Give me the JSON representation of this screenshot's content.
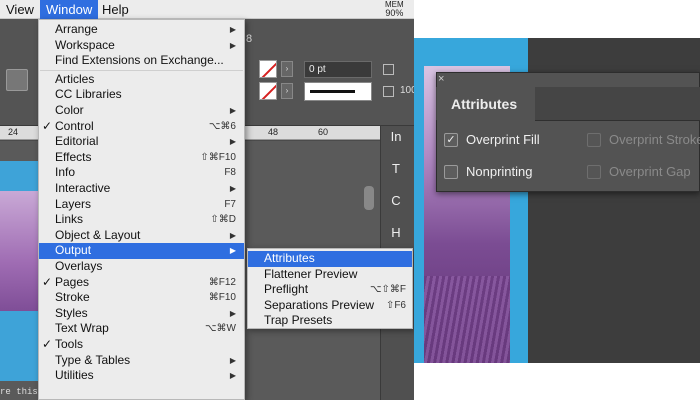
{
  "menubar": {
    "items": [
      {
        "label": "View"
      },
      {
        "label": "Window"
      },
      {
        "label": "Help"
      }
    ],
    "mem_label": "MEM",
    "mem_value": "90%"
  },
  "control_panel": {
    "tab_number": "8",
    "stroke_weight": "0 pt",
    "scale_value": "100"
  },
  "ruler": {
    "ticks": [
      "24",
      "48",
      "60"
    ]
  },
  "canvas": {
    "bottom_text": "re this t"
  },
  "tools": [
    {
      "glyph": "In"
    },
    {
      "glyph": "T"
    },
    {
      "glyph": "C"
    },
    {
      "glyph": "H"
    }
  ],
  "window_menu": {
    "items": [
      {
        "label": "Arrange",
        "checked": false,
        "shortcut": "",
        "submenu": true
      },
      {
        "label": "Workspace",
        "checked": false,
        "shortcut": "",
        "submenu": true
      },
      {
        "label": "Find Extensions on Exchange...",
        "checked": false,
        "shortcut": "",
        "submenu": false
      },
      {
        "label": "Articles",
        "checked": false,
        "shortcut": "",
        "submenu": false
      },
      {
        "label": "CC Libraries",
        "checked": false,
        "shortcut": "",
        "submenu": false
      },
      {
        "label": "Color",
        "checked": false,
        "shortcut": "",
        "submenu": true
      },
      {
        "label": "Control",
        "checked": true,
        "shortcut": "⌥⌘6",
        "submenu": false
      },
      {
        "label": "Editorial",
        "checked": false,
        "shortcut": "",
        "submenu": true
      },
      {
        "label": "Effects",
        "checked": false,
        "shortcut": "⇧⌘F10",
        "submenu": false
      },
      {
        "label": "Info",
        "checked": false,
        "shortcut": "F8",
        "submenu": false
      },
      {
        "label": "Interactive",
        "checked": false,
        "shortcut": "",
        "submenu": true
      },
      {
        "label": "Layers",
        "checked": false,
        "shortcut": "F7",
        "submenu": false
      },
      {
        "label": "Links",
        "checked": false,
        "shortcut": "⇧⌘D",
        "submenu": false
      },
      {
        "label": "Object & Layout",
        "checked": false,
        "shortcut": "",
        "submenu": true
      },
      {
        "label": "Output",
        "checked": false,
        "shortcut": "",
        "submenu": true,
        "highlighted": true
      },
      {
        "label": "Overlays",
        "checked": false,
        "shortcut": "",
        "submenu": false
      },
      {
        "label": "Pages",
        "checked": true,
        "shortcut": "⌘F12",
        "submenu": false
      },
      {
        "label": "Stroke",
        "checked": false,
        "shortcut": "⌘F10",
        "submenu": false
      },
      {
        "label": "Styles",
        "checked": false,
        "shortcut": "",
        "submenu": true
      },
      {
        "label": "Text Wrap",
        "checked": false,
        "shortcut": "⌥⌘W",
        "submenu": false
      },
      {
        "label": "Tools",
        "checked": true,
        "shortcut": "",
        "submenu": false
      },
      {
        "label": "Type & Tables",
        "checked": false,
        "shortcut": "",
        "submenu": true
      },
      {
        "label": "Utilities",
        "checked": false,
        "shortcut": "",
        "submenu": true
      }
    ],
    "check_glyph": "✓",
    "submenu_glyph": "▶"
  },
  "output_submenu": {
    "items": [
      {
        "label": "Attributes",
        "shortcut": "",
        "highlighted": true
      },
      {
        "label": "Flattener Preview",
        "shortcut": ""
      },
      {
        "label": "Preflight",
        "shortcut": "⌥⇧⌘F"
      },
      {
        "label": "Separations Preview",
        "shortcut": "⇧F6"
      },
      {
        "label": "Trap Presets",
        "shortcut": ""
      }
    ]
  },
  "attributes_panel": {
    "close_glyph": "×",
    "title": "Attributes",
    "options": [
      {
        "label": "Overprint Fill",
        "checked": true,
        "enabled": true
      },
      {
        "label": "Overprint Stroke",
        "checked": false,
        "enabled": false
      },
      {
        "label": "Nonprinting",
        "checked": false,
        "enabled": true
      },
      {
        "label": "Overprint Gap",
        "checked": false,
        "enabled": false
      }
    ],
    "check_glyph": "✓"
  },
  "colors": {
    "menu_highlight": "#2f6ee0",
    "panel_bg": "#535353",
    "page_blue": "#37a7dc"
  }
}
